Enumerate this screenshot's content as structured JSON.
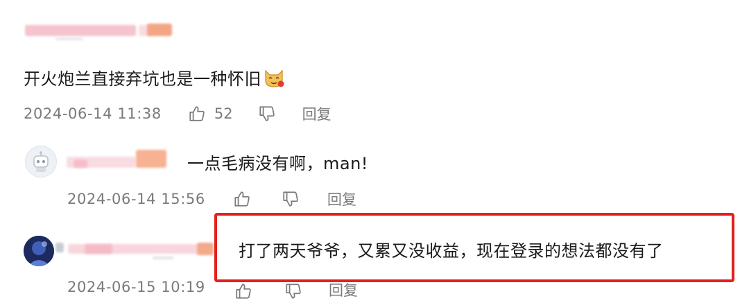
{
  "comments": [
    {
      "text": "开火炮兰直接弃坑也是一种怀旧",
      "emoji": "cat-emoji",
      "time": "2024-06-14 11:38",
      "likes": "52",
      "reply_label": "回复"
    },
    {
      "text": "一点毛病没有啊，man!",
      "time": "2024-06-14 15:56",
      "reply_label": "回复"
    },
    {
      "text": "打了两天爷爷，又累又没收益，现在登录的想法都没有了",
      "time": "2024-06-15 10:19",
      "reply_label": "回复"
    }
  ],
  "colors": {
    "highlight_border": "#e3201b",
    "meta_text": "#7a7a7a",
    "blur_pink": "#f7c6cf",
    "blur_orange": "#f4a983"
  }
}
